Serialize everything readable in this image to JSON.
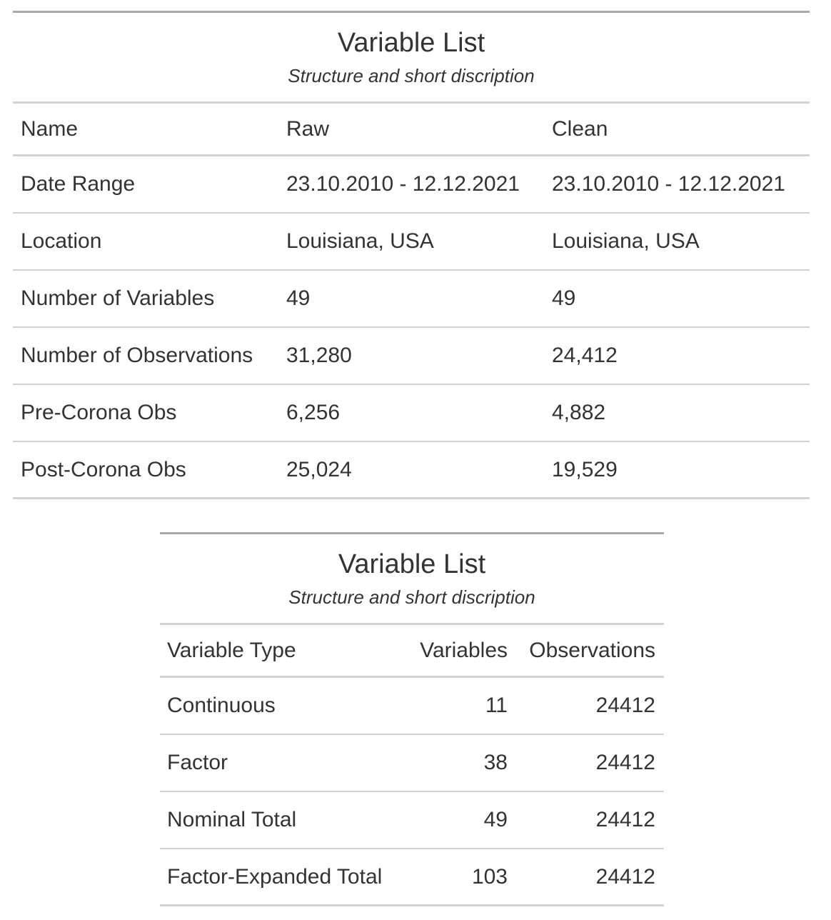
{
  "table1": {
    "title": "Variable List",
    "subtitle": "Structure and short discription",
    "columns": [
      "Name",
      "Raw",
      "Clean"
    ],
    "rows": [
      [
        "Date Range",
        "23.10.2010 - 12.12.2021",
        "23.10.2010 - 12.12.2021"
      ],
      [
        "Location",
        "Louisiana, USA",
        "Louisiana, USA"
      ],
      [
        "Number of Variables",
        "49",
        "49"
      ],
      [
        "Number of Observations",
        "31,280",
        "24,412"
      ],
      [
        "Pre-Corona Obs",
        "6,256",
        "4,882"
      ],
      [
        "Post-Corona Obs",
        "25,024",
        "19,529"
      ]
    ]
  },
  "table2": {
    "title": "Variable List",
    "subtitle": "Structure and short discription",
    "columns": [
      "Variable Type",
      "Variables",
      "Observations"
    ],
    "rows": [
      [
        "Continuous",
        "11",
        "24412"
      ],
      [
        "Factor",
        "38",
        "24412"
      ],
      [
        "Nominal Total",
        "49",
        "24412"
      ],
      [
        "Factor-Expanded Total",
        "103",
        "24412"
      ]
    ]
  }
}
